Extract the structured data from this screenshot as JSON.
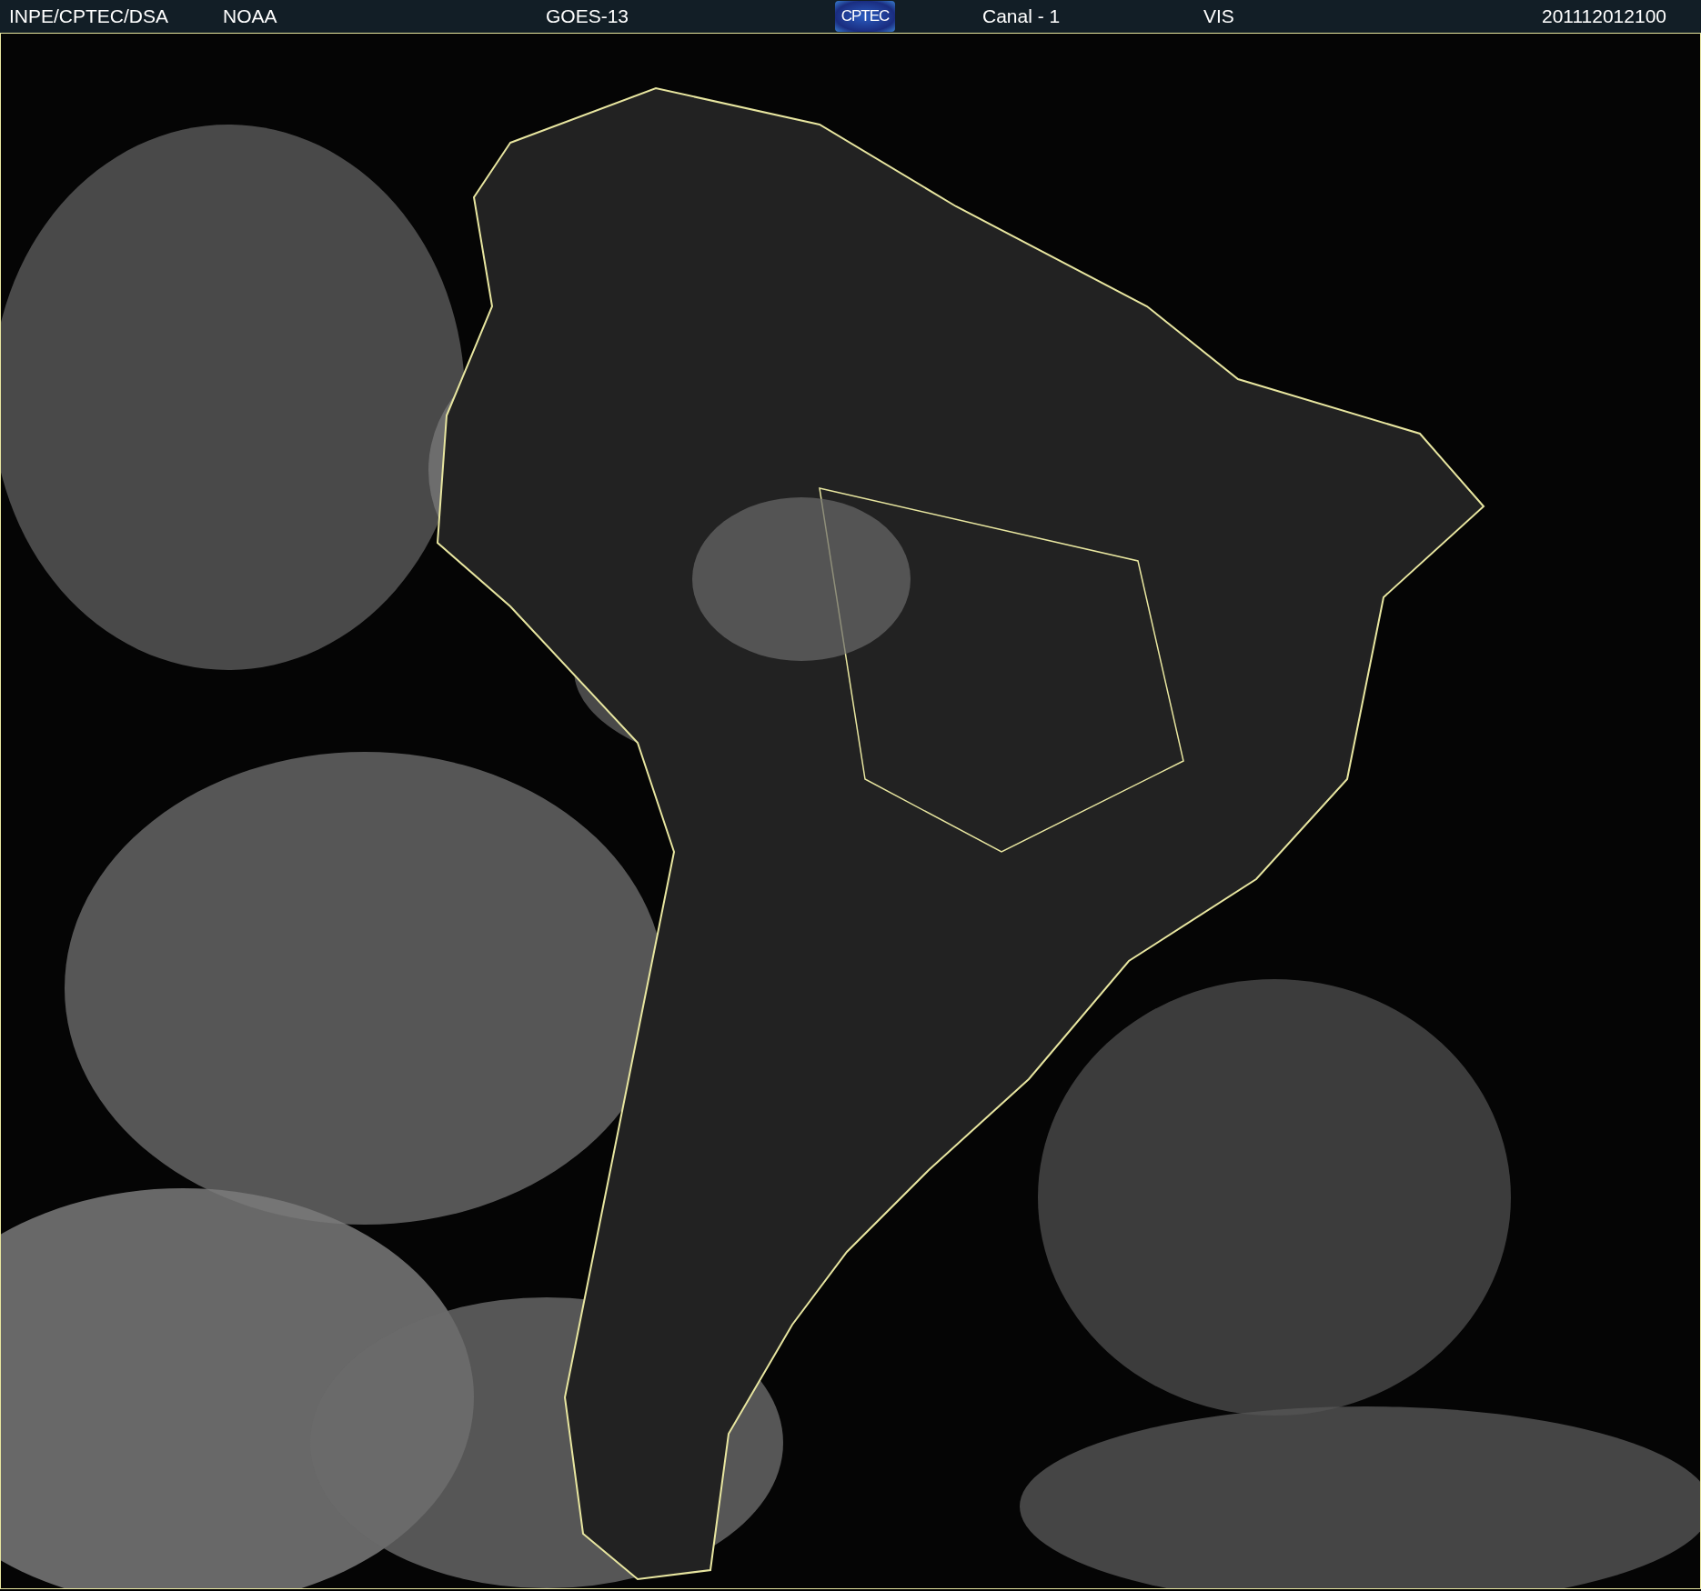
{
  "header": {
    "agency": "INPE/CPTEC/DSA",
    "provider": "NOAA",
    "satellite": "GOES-13",
    "logo": "CPTEC",
    "channel": "Canal - 1",
    "band": "VIS",
    "timestamp": "201112012100"
  }
}
